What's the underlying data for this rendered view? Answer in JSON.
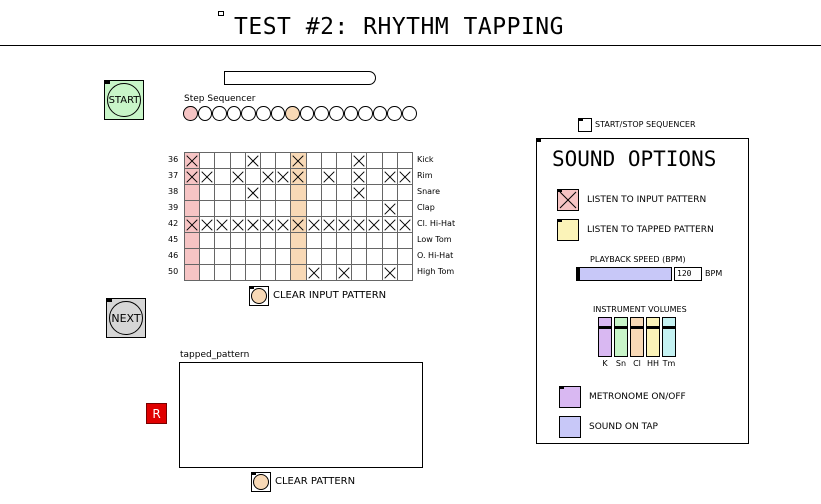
{
  "title": "TEST #2: RHYTHM TAPPING",
  "start_label": "START",
  "next_label": "NEXT",
  "record_label": "R",
  "step_sequencer_label": "Step Sequencer",
  "start_stop_sequencer_label": "START/STOP SEQUENCER",
  "clear_input_label": "CLEAR INPUT PATTERN",
  "tapped_pattern_label": "tapped_pattern",
  "clear_pattern_label": "CLEAR PATTERN",
  "colors": {
    "start": "#c8f5c8",
    "next": "#d6d6d6",
    "record": "#e00000",
    "step_pink": "#f6c4c4",
    "step_peach": "#f8d9b6"
  },
  "step_indicators": {
    "count": 16,
    "highlighted": [
      0,
      7
    ]
  },
  "grid": {
    "rows": [
      {
        "note": "36",
        "name": "Kick",
        "on": [
          0,
          4,
          7,
          11
        ]
      },
      {
        "note": "37",
        "name": "Rim",
        "on": [
          0,
          1,
          3,
          5,
          6,
          7,
          9,
          11,
          13,
          14
        ]
      },
      {
        "note": "38",
        "name": "Snare",
        "on": [
          4,
          11
        ]
      },
      {
        "note": "39",
        "name": "Clap",
        "on": [
          13
        ]
      },
      {
        "note": "42",
        "name": "Cl. Hi-Hat",
        "on": [
          0,
          1,
          2,
          3,
          4,
          5,
          6,
          7,
          8,
          9,
          10,
          11,
          12,
          13,
          14
        ]
      },
      {
        "note": "45",
        "name": "Low Tom",
        "on": []
      },
      {
        "note": "46",
        "name": "O. Hi-Hat",
        "on": []
      },
      {
        "note": "50",
        "name": "High Tom",
        "on": [
          8,
          10,
          13
        ]
      }
    ],
    "highlight_cols": {
      "0": "#f6c4c4",
      "7": "#f8d9b6"
    }
  },
  "sound_options": {
    "title": "SOUND OPTIONS",
    "listen_input_label": "LISTEN TO INPUT PATTERN",
    "listen_tapped_label": "LISTEN TO TAPPED PATTERN",
    "playback_speed_label": "PLAYBACK SPEED (BPM)",
    "bpm_value": "120",
    "bpm_unit": "BPM",
    "instrument_volumes_label": "INSTRUMENT VOLUMES",
    "volumes": [
      {
        "label": "K",
        "color": "#d9b8f2",
        "level": 0.8
      },
      {
        "label": "Sn",
        "color": "#c8f5c8",
        "level": 0.8
      },
      {
        "label": "Cl",
        "color": "#f8d9b6",
        "level": 0.8
      },
      {
        "label": "HH",
        "color": "#fbf3b8",
        "level": 0.8
      },
      {
        "label": "Tm",
        "color": "#c4f2f2",
        "level": 0.8
      }
    ],
    "metronome_label": "METRONOME ON/OFF",
    "sound_on_tap_label": "SOUND ON TAP",
    "colors": {
      "listen_input": "#f6c4c4",
      "listen_tapped": "#fbf3b8",
      "speed_slider": "#c8c8f8",
      "metronome": "#d9b8f2",
      "sound_on_tap": "#c8c8f8"
    }
  }
}
